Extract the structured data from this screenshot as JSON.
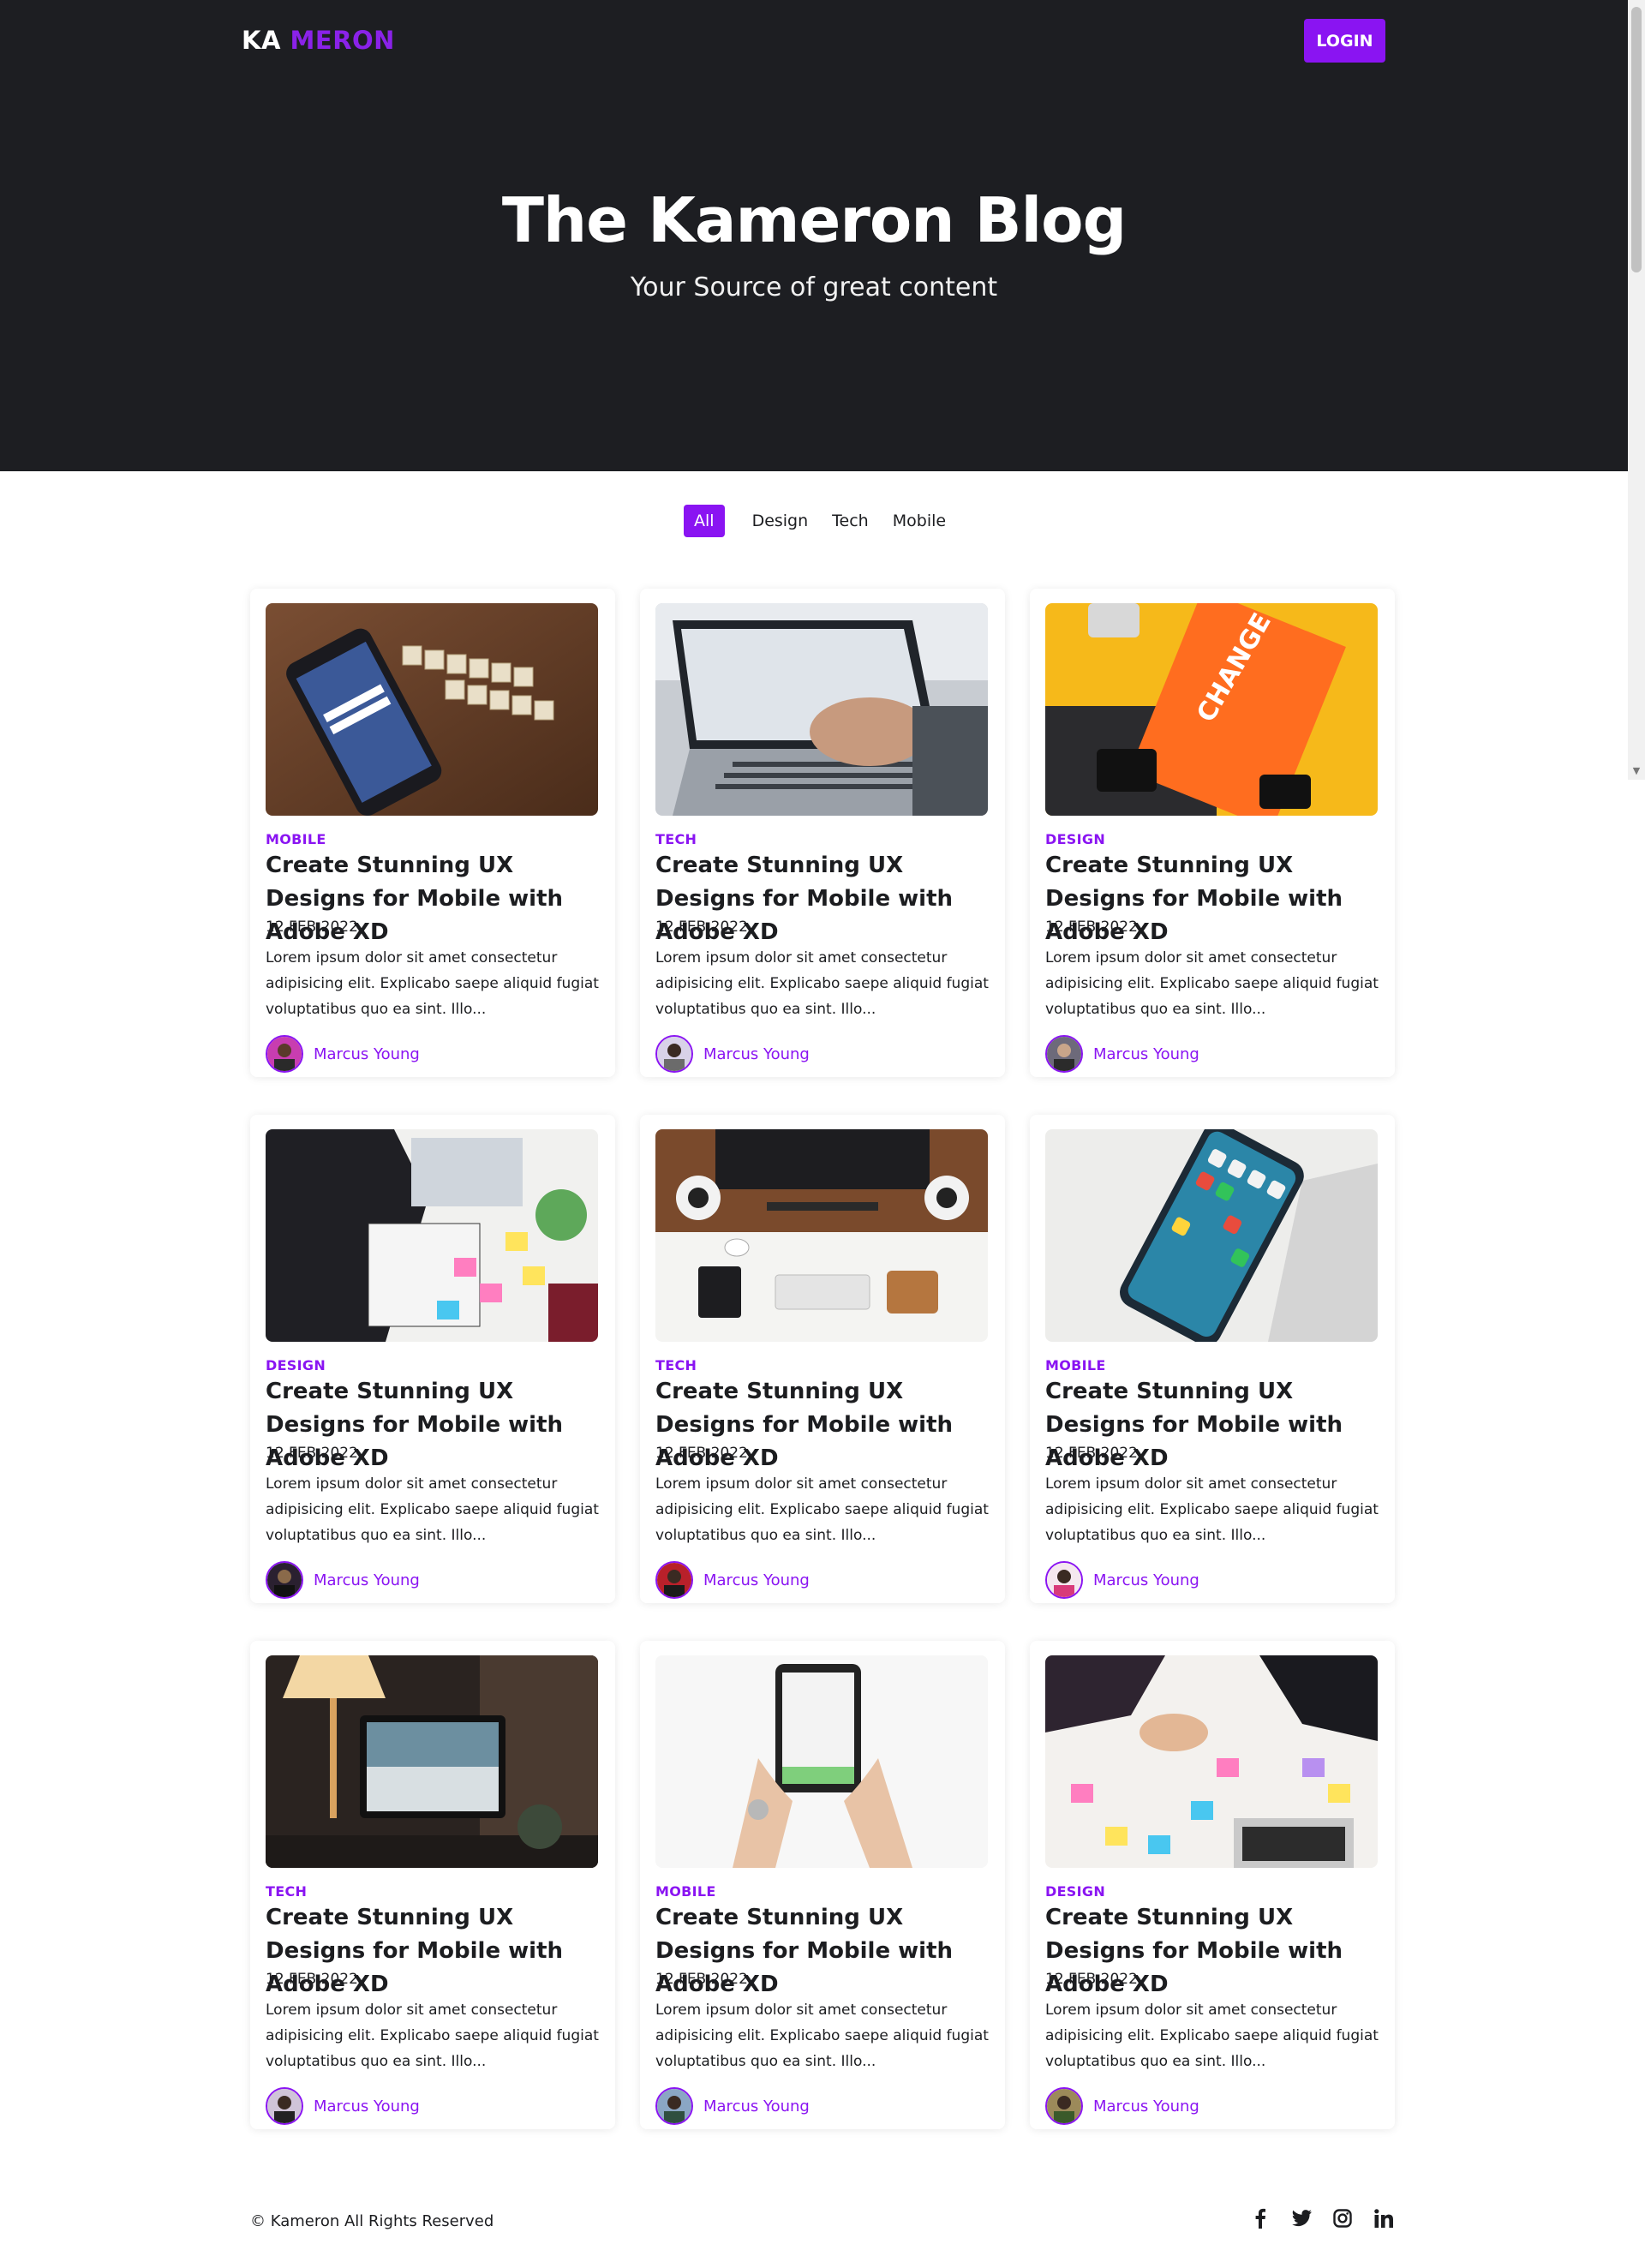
{
  "header": {
    "logo_part1": "KA",
    "logo_part2": "MERON",
    "login_label": "LOGIN",
    "title": "The Kameron Blog",
    "subtitle": "Your Source of great content"
  },
  "filters": [
    "All",
    "Design",
    "Tech",
    "Mobile"
  ],
  "posts": [
    {
      "category": "MOBILE",
      "title": "Create Stunning UX Designs for Mobile with Adobe XD",
      "date": "12 FEB 2022",
      "excerpt": "Lorem ipsum dolor sit amet consectetur adipisicing elit. Explicabo saepe aliquid fugiat voluptatibus quo ea sint. Illo...",
      "author": "Marcus Young"
    },
    {
      "category": "TECH",
      "title": "Create Stunning UX Designs for Mobile with Adobe XD",
      "date": "12 FEB 2022",
      "excerpt": "Lorem ipsum dolor sit amet consectetur adipisicing elit. Explicabo saepe aliquid fugiat voluptatibus quo ea sint. Illo...",
      "author": "Marcus Young"
    },
    {
      "category": "DESIGN",
      "title": "Create Stunning UX Designs for Mobile with Adobe XD",
      "date": "12 FEB 2022",
      "excerpt": "Lorem ipsum dolor sit amet consectetur adipisicing elit. Explicabo saepe aliquid fugiat voluptatibus quo ea sint. Illo...",
      "author": "Marcus Young"
    },
    {
      "category": "DESIGN",
      "title": "Create Stunning UX Designs for Mobile with Adobe XD",
      "date": "12 FEB 2022",
      "excerpt": "Lorem ipsum dolor sit amet consectetur adipisicing elit. Explicabo saepe aliquid fugiat voluptatibus quo ea sint. Illo...",
      "author": "Marcus Young"
    },
    {
      "category": "TECH",
      "title": "Create Stunning UX Designs for Mobile with Adobe XD",
      "date": "12 FEB 2022",
      "excerpt": "Lorem ipsum dolor sit amet consectetur adipisicing elit. Explicabo saepe aliquid fugiat voluptatibus quo ea sint. Illo...",
      "author": "Marcus Young"
    },
    {
      "category": "MOBILE",
      "title": "Create Stunning UX Designs for Mobile with Adobe XD",
      "date": "12 FEB 2022",
      "excerpt": "Lorem ipsum dolor sit amet consectetur adipisicing elit. Explicabo saepe aliquid fugiat voluptatibus quo ea sint. Illo...",
      "author": "Marcus Young"
    },
    {
      "category": "TECH",
      "title": "Create Stunning UX Designs for Mobile with Adobe XD",
      "date": "12 FEB 2022",
      "excerpt": "Lorem ipsum dolor sit amet consectetur adipisicing elit. Explicabo saepe aliquid fugiat voluptatibus quo ea sint. Illo...",
      "author": "Marcus Young"
    },
    {
      "category": "MOBILE",
      "title": "Create Stunning UX Designs for Mobile with Adobe XD",
      "date": "12 FEB 2022",
      "excerpt": "Lorem ipsum dolor sit amet consectetur adipisicing elit. Explicabo saepe aliquid fugiat voluptatibus quo ea sint. Illo...",
      "author": "Marcus Young"
    },
    {
      "category": "DESIGN",
      "title": "Create Stunning UX Designs for Mobile with Adobe XD",
      "date": "12 FEB 2022",
      "excerpt": "Lorem ipsum dolor sit amet consectetur adipisicing elit. Explicabo saepe aliquid fugiat voluptatibus quo ea sint. Illo...",
      "author": "Marcus Young"
    }
  ],
  "footer": {
    "copyright": "© Kameron All Rights Reserved",
    "social_icons": [
      "facebook-icon",
      "twitter-icon",
      "instagram-icon",
      "linkedin-icon"
    ]
  },
  "colors": {
    "accent": "#8a14f2",
    "hero_bg": "#1d1e22",
    "text": "#1c1d20"
  }
}
